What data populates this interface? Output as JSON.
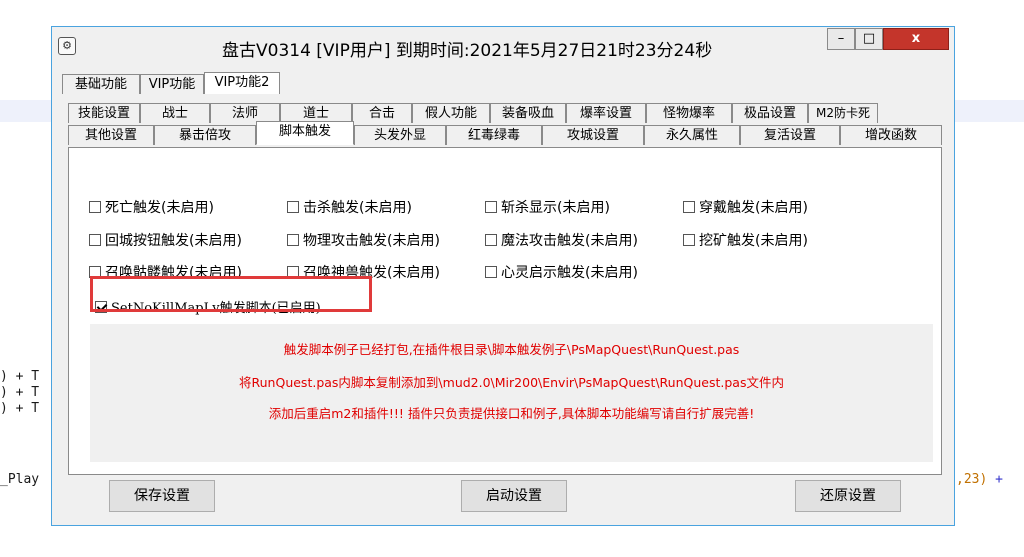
{
  "background": {
    "code_lines": [
      ") + T",
      ") + T",
      ") + T"
    ],
    "code_prefix": "_Play",
    "code_suffix_num": ",23)",
    "code_suffix_op": " +"
  },
  "window": {
    "title": "盘古V0314 [VIP用户] 到期时间:2021年5月27日21时23分24秒",
    "controls": {
      "minimize": "–",
      "maximize": "□",
      "close": "x"
    }
  },
  "tabs_main": [
    "基础功能",
    "VIP功能",
    "VIP功能2"
  ],
  "tabs_row2": [
    "技能设置",
    "战士",
    "法师",
    "道士",
    "合击",
    "假人功能",
    "装备吸血",
    "爆率设置",
    "怪物爆率",
    "极品设置",
    "M2防卡死"
  ],
  "tabs_row3": [
    "其他设置",
    "暴击倍攻",
    "脚本触发",
    "头发外显",
    "红毒绿毒",
    "攻城设置",
    "永久属性",
    "复活设置",
    "增改函数"
  ],
  "selected_main_tab": "VIP功能2",
  "selected_sub_tab": "脚本触发",
  "checkboxes": [
    {
      "label": "死亡触发(未启用)",
      "checked": false
    },
    {
      "label": "击杀触发(未启用)",
      "checked": false
    },
    {
      "label": "斩杀显示(未启用)",
      "checked": false
    },
    {
      "label": "穿戴触发(未启用)",
      "checked": false
    },
    {
      "label": "回城按钮触发(未启用)",
      "checked": false
    },
    {
      "label": "物理攻击触发(未启用)",
      "checked": false
    },
    {
      "label": "魔法攻击触发(未启用)",
      "checked": false
    },
    {
      "label": "挖矿触发(未启用)",
      "checked": false
    },
    {
      "label": "召唤骷髅触发(未启用)",
      "checked": false
    },
    {
      "label": "召唤神兽触发(未启用)",
      "checked": false
    },
    {
      "label": "心灵启示触发(未启用)",
      "checked": false
    },
    {
      "label": "SetNoKillMapLv触发脚本(已启用)",
      "checked": true
    }
  ],
  "notes": [
    "触发脚本例子已经打包,在插件根目录\\脚本触发例子\\PsMapQuest\\RunQuest.pas",
    "将RunQuest.pas内脚本复制添加到\\mud2.0\\Mir200\\Envir\\PsMapQuest\\RunQuest.pas文件内",
    "添加后重启m2和插件!!! 插件只负责提供接口和例子,具体脚本功能编写请自行扩展完善!"
  ],
  "colors": {
    "note_text": "#e00000",
    "highlight_border": "#e03a3a",
    "window_border": "#4aa3df"
  },
  "buttons": {
    "save": "保存设置",
    "start": "启动设置",
    "restore": "还原设置"
  }
}
